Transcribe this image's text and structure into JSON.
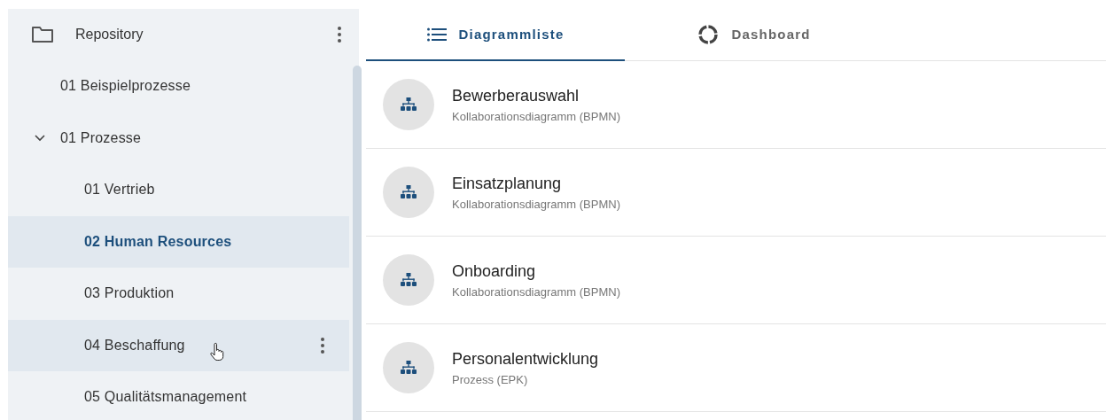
{
  "sidebar": {
    "title": "Repository",
    "tree": [
      {
        "label": "01 Beispielprozesse",
        "selected": false,
        "hovered": false
      },
      {
        "label": "01 Prozesse",
        "selected": false,
        "hovered": false,
        "expanded": true,
        "children": [
          {
            "label": "01 Vertrieb",
            "selected": false,
            "hovered": false
          },
          {
            "label": "02 Human Resources",
            "selected": true,
            "hovered": false
          },
          {
            "label": "03 Produktion",
            "selected": false,
            "hovered": false
          },
          {
            "label": "04 Beschaffung",
            "selected": false,
            "hovered": true
          },
          {
            "label": "05 Qualitätsmanagement",
            "selected": false,
            "hovered": false
          }
        ]
      }
    ]
  },
  "tabs": [
    {
      "label": "Diagrammliste",
      "selected": true,
      "kind": "list"
    },
    {
      "label": "Dashboard",
      "selected": false,
      "kind": "ring"
    }
  ],
  "diagrams": [
    {
      "title": "Bewerberauswahl",
      "type": "Kollaborationsdiagramm (BPMN)"
    },
    {
      "title": "Einsatzplanung",
      "type": "Kollaborationsdiagramm (BPMN)"
    },
    {
      "title": "Onboarding",
      "type": "Kollaborationsdiagramm (BPMN)"
    },
    {
      "title": "Personalentwicklung",
      "type": "Prozess (EPK)"
    }
  ]
}
